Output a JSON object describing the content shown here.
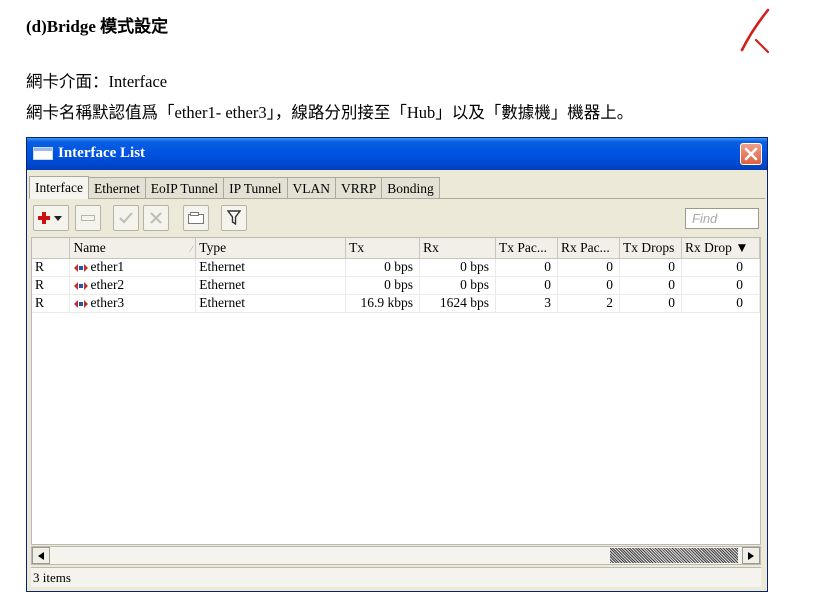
{
  "document": {
    "heading": "(d)Bridge 模式設定",
    "line1": "網卡介面：Interface",
    "line2": "網卡名稱默認值爲「ether1- ether3」，線路分別接至「Hub」以及「數據機」機器上。"
  },
  "window": {
    "title": "Interface List",
    "tabs": [
      {
        "label": "Interface",
        "active": true
      },
      {
        "label": "Ethernet"
      },
      {
        "label": "EoIP Tunnel"
      },
      {
        "label": "IP Tunnel"
      },
      {
        "label": "VLAN"
      },
      {
        "label": "VRRP"
      },
      {
        "label": "Bonding"
      }
    ],
    "toolbar": {
      "buttons": [
        "add-icon",
        "remove-icon",
        "enable-icon",
        "disable-icon",
        "comment-icon",
        "filter-icon"
      ],
      "find_placeholder": "Find"
    },
    "columns": [
      "",
      "Name",
      "Type",
      "Tx",
      "Rx",
      "Tx Pac...",
      "Rx Pac...",
      "Tx Drops",
      "Rx Drop"
    ],
    "rows": [
      {
        "flag": "R",
        "name": "ether1",
        "type": "Ethernet",
        "tx": "0 bps",
        "rx": "0 bps",
        "tx_packets": "0",
        "rx_packets": "0",
        "tx_drops": "0",
        "rx_drops": "0"
      },
      {
        "flag": "R",
        "name": "ether2",
        "type": "Ethernet",
        "tx": "0 bps",
        "rx": "0 bps",
        "tx_packets": "0",
        "rx_packets": "0",
        "tx_drops": "0",
        "rx_drops": "0"
      },
      {
        "flag": "R",
        "name": "ether3",
        "type": "Ethernet",
        "tx": "16.9 kbps",
        "rx": "1624 bps",
        "tx_packets": "3",
        "rx_packets": "2",
        "tx_drops": "0",
        "rx_drops": "0"
      }
    ],
    "status": "3 items",
    "colors": {
      "titlebar": "#0053e1",
      "close": "#e05f3f",
      "add": "#cc1111"
    }
  }
}
